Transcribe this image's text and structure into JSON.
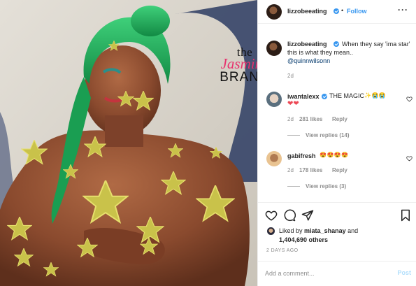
{
  "photo": {
    "alt_subject": "woman with green hair and gold star glitter",
    "watermark": {
      "line1": "the",
      "line2": "Jasmine",
      "line3": "BRAND"
    }
  },
  "header": {
    "username": "lizzobeeating",
    "separator": "•",
    "follow_label": "Follow",
    "more_label": "···"
  },
  "caption": {
    "username": "lizzobeeating",
    "text": "When they say 'ima star' this is what they mean..",
    "mention": "@quinnwilsonn",
    "time": "2d"
  },
  "comments": [
    {
      "username": "iwantalexx",
      "text": "THE MAGIC",
      "emoji": "✨😭😭",
      "time": "2d",
      "likes": "281 likes",
      "reply_label": "Reply",
      "view_replies": "View replies (14)"
    },
    {
      "username": "gabifresh",
      "text": "",
      "emoji": "😍😍😍😍",
      "time": "2d",
      "likes": "178 likes",
      "reply_label": "Reply",
      "view_replies": "View replies (3)"
    }
  ],
  "likes": {
    "liked_by_prefix": "Liked by",
    "liked_by_user": "miata_shanay",
    "and_label": "and",
    "count": "1,404,690 others",
    "time_ago": "2 DAYS AGO"
  },
  "comment_box": {
    "placeholder": "Add a comment...",
    "post_label": "Post"
  },
  "colors": {
    "accent": "#3897f0",
    "heart_red": "#ed4956",
    "post_disabled": "#b2dffc",
    "meta_gray": "#8e8e8e"
  },
  "icons": [
    "heart-icon",
    "comment-icon",
    "share-icon",
    "bookmark-icon",
    "verified-badge-icon",
    "more-options-icon"
  ]
}
